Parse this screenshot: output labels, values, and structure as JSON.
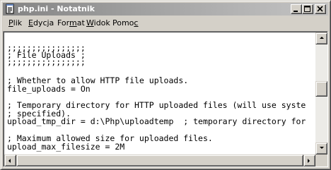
{
  "window": {
    "title": "php.ini - Notatnik",
    "icon": "notepad-icon"
  },
  "menu": [
    {
      "label": "Plik",
      "mnemonic": "P",
      "rest": "lik"
    },
    {
      "label": "Edycja",
      "mnemonic": "E",
      "rest": "dycja"
    },
    {
      "label": "Format",
      "pre": "For",
      "mnemonic": "m",
      "rest": "at"
    },
    {
      "label": "Widok",
      "mnemonic": "W",
      "rest": "idok"
    },
    {
      "label": "Pomoc",
      "pre": "Pomo",
      "mnemonic": "c",
      "rest": ""
    }
  ],
  "editor": {
    "lines": [
      ";;;;;;;;;;;;;;;;",
      "; File Uploads ;",
      ";;;;;;;;;;;;;;;;",
      "",
      "; Whether to allow HTTP file uploads.",
      "file_uploads = On",
      "",
      "; Temporary directory for HTTP uploaded files (will use syste",
      "; specified).",
      "upload_tmp_dir = d:\\Php\\uploadtemp  ; temporary directory for",
      "",
      "; Maximum allowed size for uploaded files.",
      "upload_max_filesize = 2M"
    ]
  },
  "colors": {
    "titlebar_start": "#848484",
    "titlebar_end": "#c4c4c4",
    "chrome": "#d4d0c8",
    "editor_bg": "#ffffff"
  }
}
